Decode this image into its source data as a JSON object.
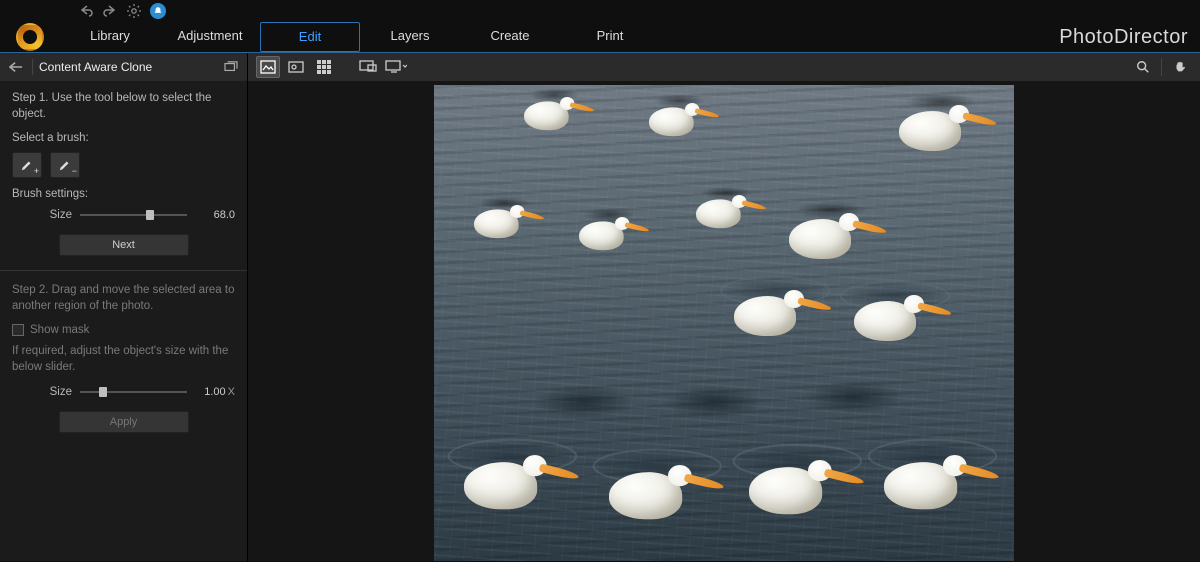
{
  "brand": "PhotoDirector",
  "tabs": {
    "library": "Library",
    "adjustment": "Adjustment",
    "edit": "Edit",
    "layers": "Layers",
    "create": "Create",
    "print": "Print"
  },
  "active_tab": "edit",
  "panel": {
    "title": "Content Aware Clone",
    "step1": "Step 1. Use the tool below to select the object.",
    "select_brush": "Select a brush:",
    "brush_settings": "Brush settings:",
    "size_label": "Size",
    "size_value": "68.0",
    "size_pct": 62,
    "next": "Next",
    "step2": "Step 2. Drag and move the selected area to another region of the photo.",
    "show_mask": "Show mask",
    "adjust_text": "If required, adjust the object's size with the below slider.",
    "scale_label": "Size",
    "scale_value": "1.00",
    "scale_unit": "X",
    "scale_pct": 18,
    "apply": "Apply"
  }
}
